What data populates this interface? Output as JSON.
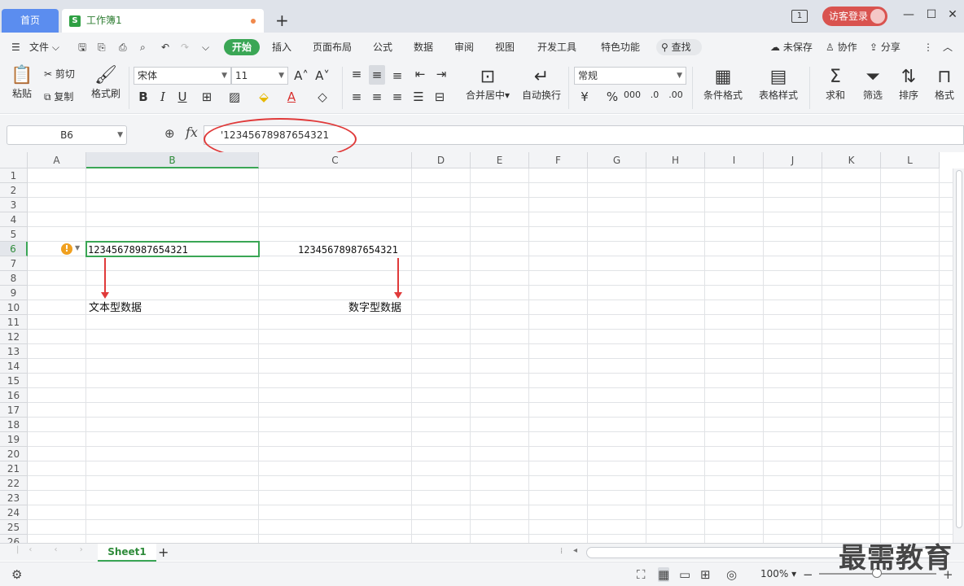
{
  "titlebar": {
    "home_tab": "首页",
    "doc_icon": "S",
    "doc_tab": "工作簿1",
    "add_tab": "+",
    "badge": "1",
    "login": "访客登录",
    "min": "—",
    "restore": "☐",
    "close": "✕"
  },
  "menu": {
    "file": "文件",
    "start": "开始",
    "insert": "插入",
    "layout": "页面布局",
    "formula": "公式",
    "data": "数据",
    "review": "审阅",
    "view": "视图",
    "dev": "开发工具",
    "special": "特色功能",
    "search": "查找",
    "unsaved": "未保存",
    "collab": "协作",
    "share": "分享"
  },
  "ribbon": {
    "paste": "粘贴",
    "cut": "剪切",
    "copy": "复制",
    "format_painter": "格式刷",
    "font_name": "宋体",
    "font_size": "11",
    "bold": "B",
    "italic": "I",
    "underline": "U",
    "merge_center": "合并居中",
    "wrap": "自动换行",
    "number_format": "常规",
    "currency": "¥",
    "percent": "%",
    "cond_format": "条件格式",
    "table_style": "表格样式",
    "sum": "求和",
    "filter": "筛选",
    "sort": "排序",
    "format": "格式"
  },
  "formula_bar": {
    "name_box": "B6",
    "fx": "fx",
    "content": "'12345678987654321"
  },
  "grid": {
    "columns": [
      "A",
      "B",
      "C",
      "D",
      "E",
      "F",
      "G",
      "H",
      "I",
      "J",
      "K",
      "L"
    ],
    "rows": [
      "1",
      "2",
      "3",
      "4",
      "5",
      "6",
      "7",
      "8",
      "9",
      "10",
      "11",
      "12",
      "13",
      "14",
      "15",
      "16",
      "17",
      "18",
      "19",
      "20",
      "21",
      "22",
      "23",
      "24",
      "25",
      "26"
    ],
    "b6": "12345678987654321",
    "c6": "12345678987654321",
    "b10": "文本型数据",
    "c10": "数字型数据"
  },
  "sheets": {
    "active": "Sheet1",
    "add": "+"
  },
  "status": {
    "zoom": "100%",
    "minus": "−",
    "plus": "+"
  },
  "watermark": "最需教育",
  "colors": {
    "accent_green": "#3aa655",
    "home_tab_blue": "#5b8def",
    "annotation_red": "#e03a3a",
    "login_red": "#d9534f"
  }
}
